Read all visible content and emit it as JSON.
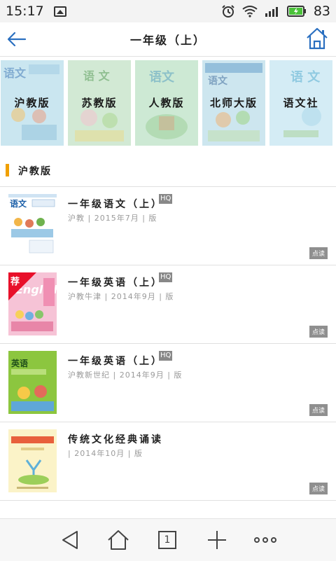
{
  "status_bar": {
    "time": "15:17",
    "battery_level": "83"
  },
  "header": {
    "title": "一年级（上）"
  },
  "versions": [
    {
      "label": "沪教版",
      "cover_text": "语文"
    },
    {
      "label": "苏教版",
      "cover_text": "语 文"
    },
    {
      "label": "人教版",
      "cover_text": "语文"
    },
    {
      "label": "北师大版",
      "cover_text": "语文"
    },
    {
      "label": "语文社",
      "cover_text": "语 文"
    }
  ],
  "section": {
    "title": "沪教版"
  },
  "books": [
    {
      "title": "一年级语文（上）",
      "hq": "HQ",
      "meta": "沪教 | 2015年7月 | 版",
      "read": "点读",
      "cover_text": "语文",
      "recommended": ""
    },
    {
      "title": "一年级英语（上）",
      "hq": "HQ",
      "meta": "沪教牛津 | 2014年9月 | 版",
      "read": "点读",
      "cover_text": "English",
      "recommended": "荐"
    },
    {
      "title": "一年级英语（上）",
      "hq": "HQ",
      "meta": "沪教新世纪 | 2014年9月 | 版",
      "read": "点读",
      "cover_text": "英语",
      "recommended": ""
    },
    {
      "title": "传统文化经典诵读",
      "hq": "",
      "meta": "| 2014年10月 | 版",
      "read": "点读",
      "cover_text": "",
      "recommended": ""
    }
  ],
  "bottom_nav": {
    "tab_count": "1"
  },
  "colors": {
    "accent": "#2a6fc0",
    "section_bar": "#f0a000",
    "recommend": "#e8102a"
  }
}
